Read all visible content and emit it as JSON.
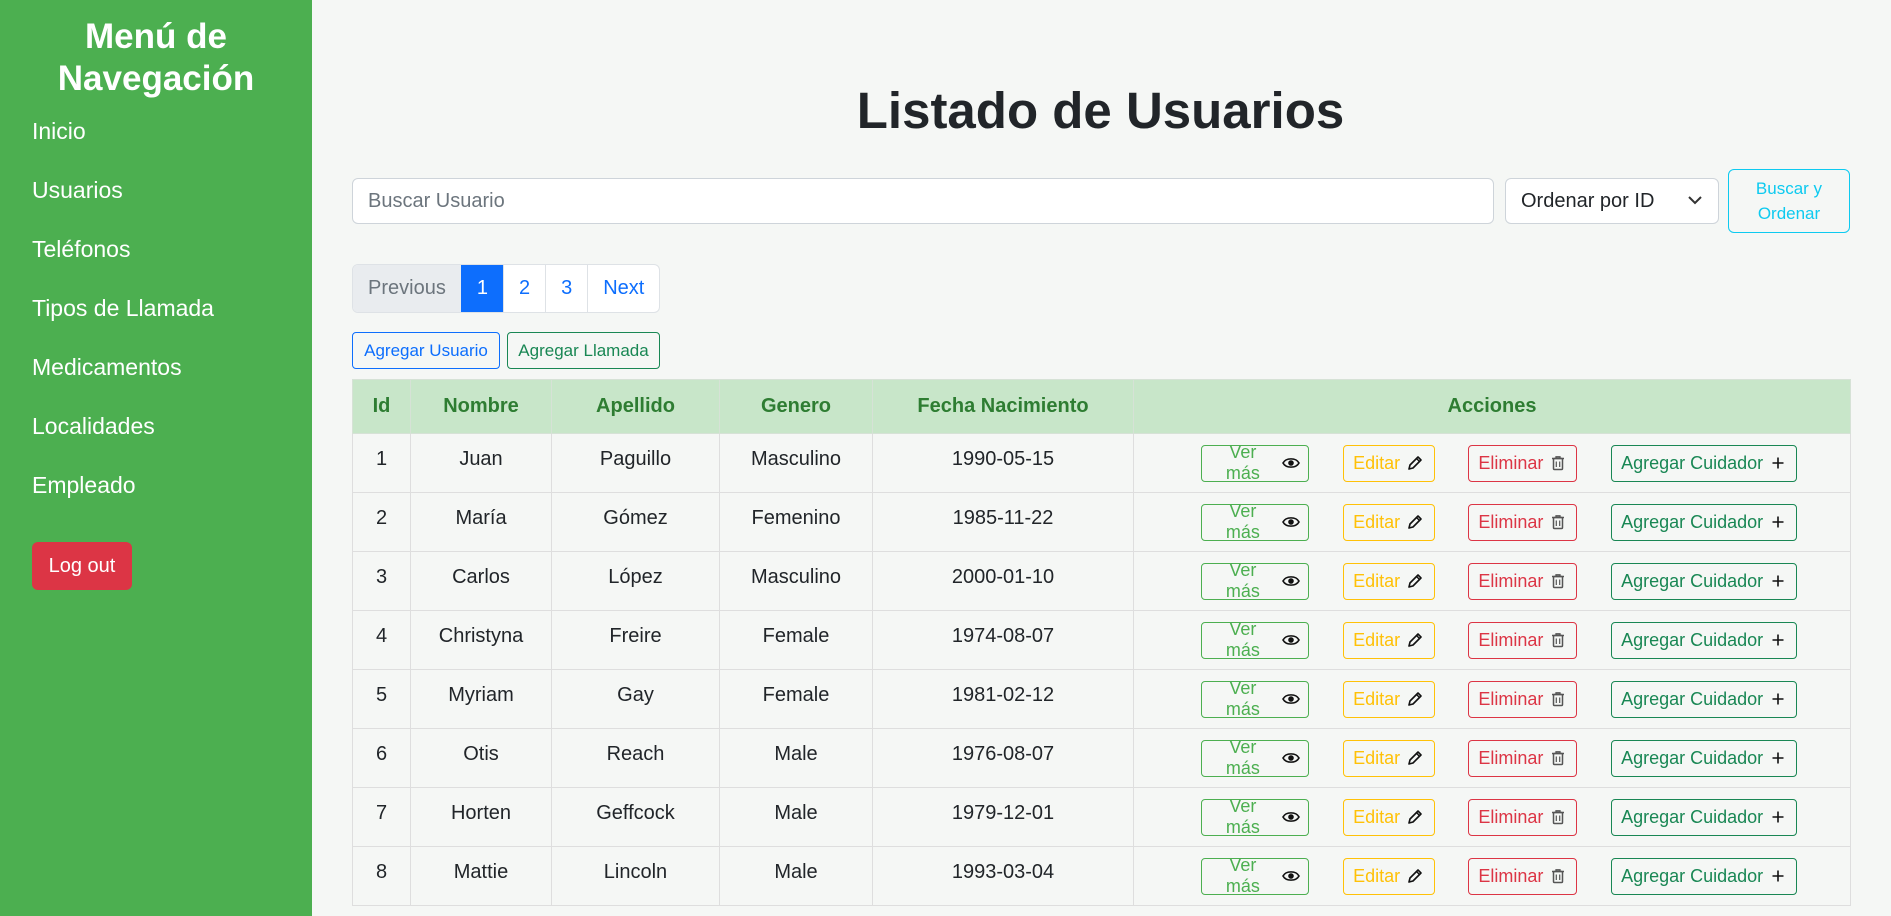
{
  "sidebar": {
    "title": "Menú de Navegación",
    "items": [
      {
        "label": "Inicio"
      },
      {
        "label": "Usuarios"
      },
      {
        "label": "Teléfonos"
      },
      {
        "label": "Tipos de Llamada"
      },
      {
        "label": "Medicamentos"
      },
      {
        "label": "Localidades"
      },
      {
        "label": "Empleado"
      }
    ],
    "logout_label": "Log out"
  },
  "main": {
    "title": "Listado de Usuarios",
    "search": {
      "placeholder": "Buscar Usuario",
      "value": ""
    },
    "order_select": {
      "selected": "Ordenar por ID"
    },
    "search_button_label": "Buscar y Ordenar",
    "pagination": {
      "previous": "Previous",
      "pages": [
        "1",
        "2",
        "3"
      ],
      "active": "1",
      "next": "Next"
    },
    "add_user_label": "Agregar Usuario",
    "add_call_label": "Agregar Llamada"
  },
  "table": {
    "headers": [
      "Id",
      "Nombre",
      "Apellido",
      "Genero",
      "Fecha Nacimiento",
      "Acciones"
    ],
    "rows": [
      {
        "id": "1",
        "nombre": "Juan",
        "apellido": "Paguillo",
        "genero": "Masculino",
        "fecha": "1990-05-15"
      },
      {
        "id": "2",
        "nombre": "María",
        "apellido": "Gómez",
        "genero": "Femenino",
        "fecha": "1985-11-22"
      },
      {
        "id": "3",
        "nombre": "Carlos",
        "apellido": "López",
        "genero": "Masculino",
        "fecha": "2000-01-10"
      },
      {
        "id": "4",
        "nombre": "Christyna",
        "apellido": "Freire",
        "genero": "Female",
        "fecha": "1974-08-07"
      },
      {
        "id": "5",
        "nombre": "Myriam",
        "apellido": "Gay",
        "genero": "Female",
        "fecha": "1981-02-12"
      },
      {
        "id": "6",
        "nombre": "Otis",
        "apellido": "Reach",
        "genero": "Male",
        "fecha": "1976-08-07"
      },
      {
        "id": "7",
        "nombre": "Horten",
        "apellido": "Geffcock",
        "genero": "Male",
        "fecha": "1979-12-01"
      },
      {
        "id": "8",
        "nombre": "Mattie",
        "apellido": "Lincoln",
        "genero": "Male",
        "fecha": "1993-03-04"
      }
    ],
    "actions": {
      "view_label": "Ver más",
      "edit_label": "Editar",
      "delete_label": "Eliminar",
      "caregiver_label": "Agregar Cuidador",
      "view_icon": "eye-icon",
      "edit_icon": "pencil-icon",
      "delete_icon": "trash-icon",
      "caregiver_icon": "plus-icon"
    }
  },
  "colors": {
    "sidebar": "#4caf50",
    "logout": "#dc3545",
    "primary": "#0d6efd",
    "table_header_bg": "#c8e6c9",
    "table_header_text": "#2e7d32",
    "info": "#0dcaf0",
    "warning": "#ffc107",
    "danger": "#dc3545",
    "success": "#198754"
  }
}
